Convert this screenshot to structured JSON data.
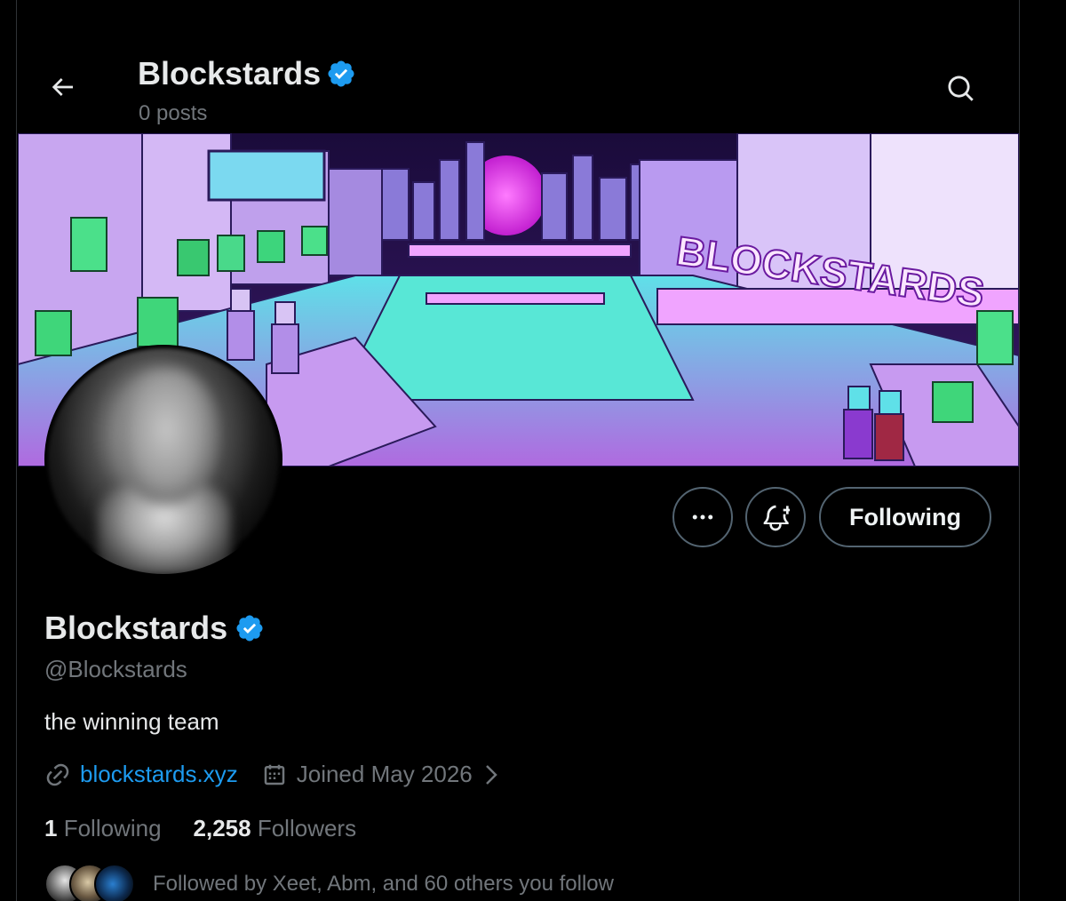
{
  "header": {
    "name": "Blockstards",
    "posts": "0 posts",
    "back_icon": "arrow-left-icon",
    "search_icon": "search-icon",
    "verified_icon": "verified-badge-icon"
  },
  "profile": {
    "name": "Blockstards",
    "handle": "@Blockstards",
    "bio": "the winning team",
    "website": "blockstards.xyz",
    "joined": "Joined May 2026",
    "following_count": "1",
    "following_label": "Following",
    "followers_count": "2,258",
    "followers_label": "Followers",
    "followed_by": "Followed by Xeet, Abm, and 60 others you follow"
  },
  "actions": {
    "more_icon": "more-dots-icon",
    "notify_icon": "bell-plus-icon",
    "follow_label": "Following"
  },
  "colors": {
    "accent": "#1d9bf0",
    "muted": "#71767b",
    "text": "#e7e9ea",
    "background": "#000000"
  }
}
